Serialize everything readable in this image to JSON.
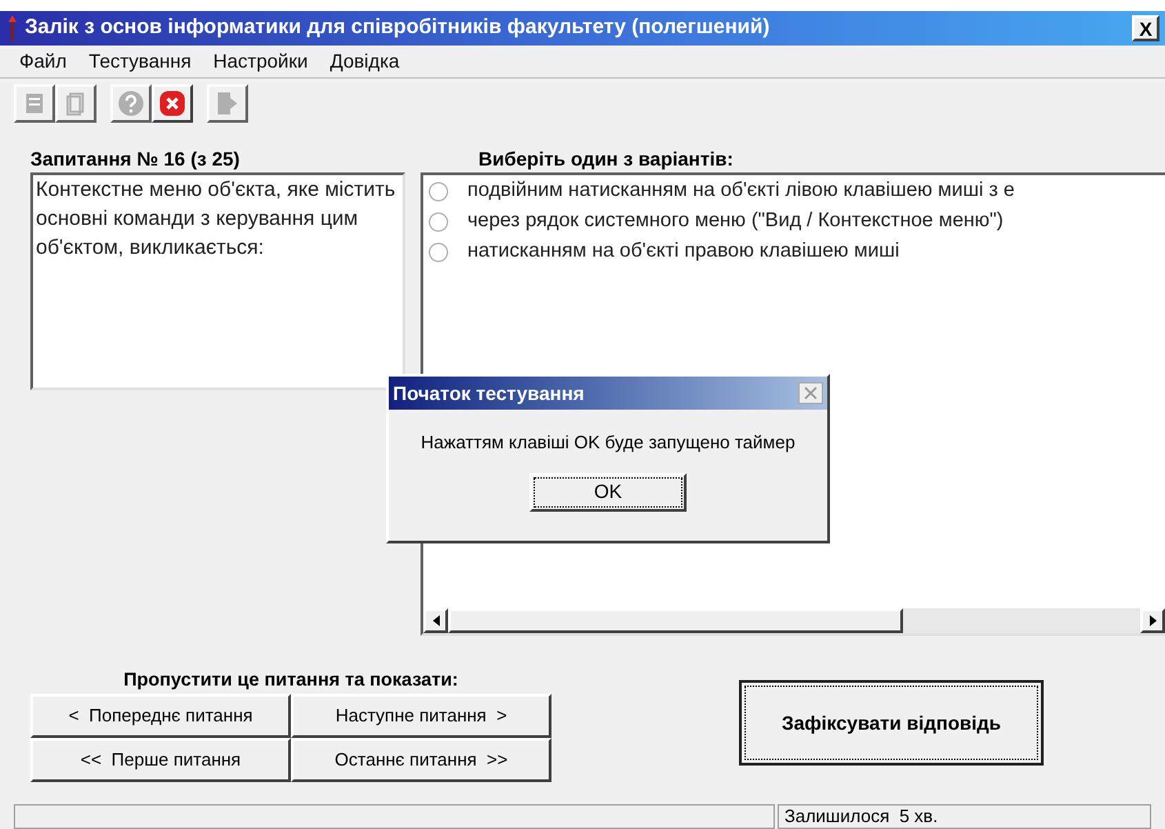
{
  "window": {
    "title": "Залік з основ інформатики для співробітників факультету (полегшений)",
    "close": "X"
  },
  "menu": [
    "Файл",
    "Тестування",
    "Настройки",
    "Довідка"
  ],
  "toolbar": [
    {
      "kind": "print",
      "disabled": true
    },
    {
      "kind": "pages",
      "disabled": true
    },
    {
      "kind": "help",
      "disabled": true
    },
    {
      "kind": "stop",
      "disabled": false
    },
    {
      "kind": "exit",
      "disabled": true
    }
  ],
  "question": {
    "heading": "Запитання № 16 (з 25)",
    "text": "Контекстне меню об'єкта, яке містить основні команди з керування цим об'єктом, викликається:"
  },
  "answers": {
    "heading": "Виберіть один з варіантів:",
    "options": [
      {
        "label": "подвійним натисканням на об'єкті лівою клавішею миші з е",
        "selected": false
      },
      {
        "label": "через рядок системного меню (\"Вид / Контекстное меню\")",
        "selected": false
      },
      {
        "label": "натисканням на об'єкті правою клавішею миші",
        "selected": false
      }
    ]
  },
  "navigation": {
    "heading": "Пропустити це питання та показати:",
    "buttons": [
      "<  Попереднє питання",
      "Наступне питання  >",
      "<<  Перше питання",
      "Останнє питання  >>"
    ]
  },
  "submit": "Зафіксувати відповідь",
  "status_bar": [
    "Залишилося  5 хв."
  ],
  "dialog": {
    "title": "Початок тестування",
    "message": "Нажаттям клавіші OK буде запущено таймер",
    "button": "OK"
  }
}
